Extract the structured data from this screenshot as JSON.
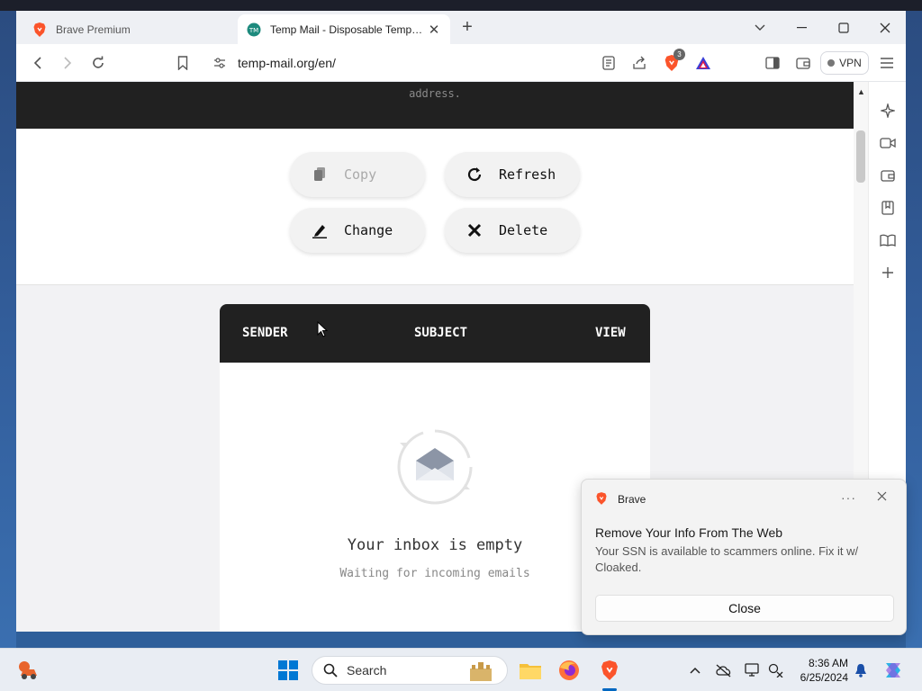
{
  "browser": {
    "tabs": [
      {
        "title": "Brave Premium"
      },
      {
        "title": "Temp Mail - Disposable Temporary Email",
        "close": "✕"
      }
    ],
    "new_tab": "+",
    "url": "temp-mail.org/en/",
    "shields_badge": "3",
    "vpn_label": "VPN"
  },
  "page": {
    "address_caption": "address.",
    "actions": {
      "copy": "Copy",
      "refresh": "Refresh",
      "change": "Change",
      "delete": "Delete"
    },
    "inbox": {
      "columns": [
        "SENDER",
        "SUBJECT",
        "VIEW"
      ],
      "empty_title": "Your inbox is empty",
      "empty_subtitle": "Waiting for incoming emails"
    }
  },
  "notification": {
    "app": "Brave",
    "more": "···",
    "title": "Remove Your Info From The Web",
    "body": "Your SSN is available to scammers online. Fix it w/ Cloaked.",
    "button": "Close"
  },
  "taskbar": {
    "search_placeholder": "Search",
    "time": "8:36 AM",
    "date": "6/25/2024"
  },
  "colors": {
    "brave_orange": "#fb542b",
    "dark_band": "#212121",
    "windows_blue": "#0067c0"
  }
}
